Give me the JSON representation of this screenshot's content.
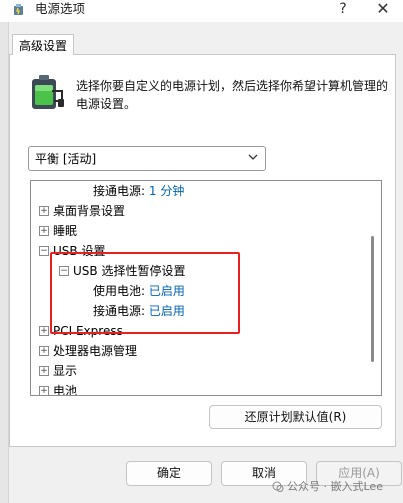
{
  "window": {
    "title": "电源选项",
    "help_glyph": "?",
    "close_glyph": "✕"
  },
  "tab": {
    "label": "高级设置"
  },
  "description": "选择你要自定义的电源计划，然后选择你希望计算机管理的电源设置。",
  "plan_select": {
    "value": "平衡 [活动]"
  },
  "tree": {
    "top_row": {
      "label": "接通电源:",
      "value": "1 分钟"
    },
    "items": [
      {
        "toggle": "+",
        "label": "桌面背景设置"
      },
      {
        "toggle": "+",
        "label": "睡眠"
      },
      {
        "toggle": "−",
        "label": "USB 设置"
      }
    ],
    "usb_sub": {
      "toggle": "−",
      "label": "USB 选择性暂停设置"
    },
    "usb_values": [
      {
        "label": "使用电池:",
        "value": "已启用"
      },
      {
        "label": "接通电源:",
        "value": "已启用"
      }
    ],
    "items_after": [
      {
        "toggle": "+",
        "label": "PCI Express"
      },
      {
        "toggle": "+",
        "label": "处理器电源管理"
      },
      {
        "toggle": "+",
        "label": "显示"
      },
      {
        "toggle": "+",
        "label": "电池"
      }
    ]
  },
  "buttons": {
    "restore": "还原计划默认值(R)",
    "ok": "确定",
    "cancel": "取消",
    "apply": "应用(A)"
  },
  "watermark": "公众号 · 嵌入式Lee",
  "colors": {
    "link_blue": "#0063b1",
    "highlight_red": "#e82020"
  }
}
